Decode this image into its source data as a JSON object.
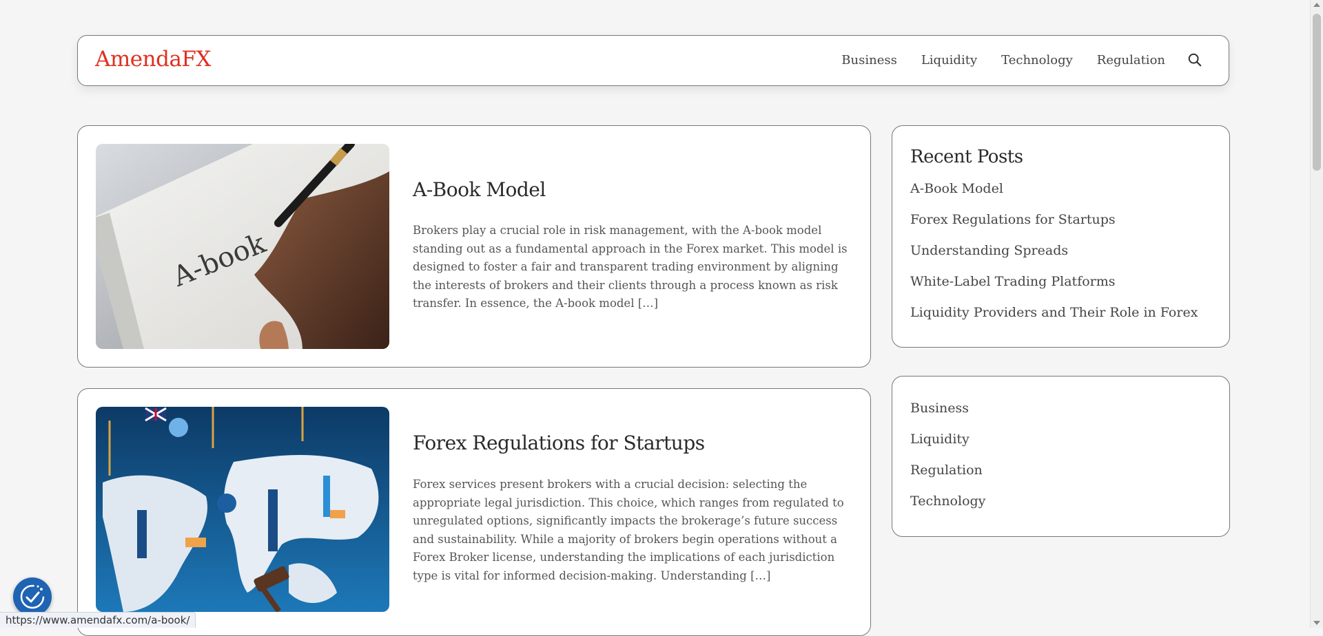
{
  "header": {
    "logo": "AmendaFX",
    "nav": [
      "Business",
      "Liquidity",
      "Technology",
      "Regulation"
    ],
    "search_icon": "search-icon"
  },
  "posts": [
    {
      "title": "A-Book Model",
      "excerpt": "Brokers play a crucial role in risk management, with the A-book model standing out as a fundamental approach in the Forex market. This model is designed to foster a fair and transparent trading environment by aligning the interests of brokers and their clients through a process known as risk transfer. In essence, the A-book model […]",
      "image_text": "A-book"
    },
    {
      "title": "Forex Regulations for Startups",
      "excerpt": "Forex services present brokers with a crucial decision: selecting the appropriate legal jurisdiction. This choice, which ranges from regulated to unregulated options, significantly impacts the brokerage’s future success and sustainability. While a majority of brokers begin operations without a Forex Broker license, understanding the implications of each jurisdiction type is vital for informed decision-making. Understanding […]"
    }
  ],
  "sidebar": {
    "recent_title": "Recent Posts",
    "recent_posts": [
      "A-Book Model",
      "Forex Regulations for Startups",
      "Understanding Spreads",
      "White-Label Trading Platforms",
      "Liquidity Providers and Their Role in Forex"
    ],
    "categories": [
      "Business",
      "Liquidity",
      "Regulation",
      "Technology"
    ]
  },
  "status_url": "https://www.amendafx.com/a-book/",
  "colors": {
    "logo": "#e0301e",
    "cookie_button": "#1f63b3"
  }
}
